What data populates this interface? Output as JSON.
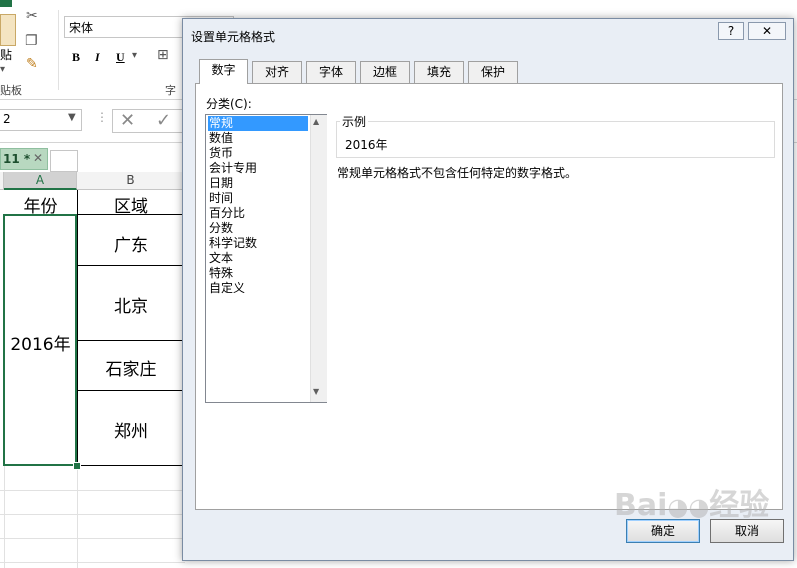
{
  "excel": {
    "ribbon": {
      "paste_label": "贴",
      "clipboard_group": "贴板",
      "font_group": "字",
      "font_name": "宋体",
      "bold": "B",
      "italic": "I",
      "underline": "U"
    },
    "formula_bar": {
      "name_box": "2"
    },
    "sheet_tab": {
      "label": "11 *",
      "close": "✕"
    },
    "grid": {
      "columns": [
        "A",
        "B"
      ],
      "header_cells": [
        "年份",
        "区域"
      ],
      "year_cell": "2016年",
      "regions": [
        "广东",
        "北京",
        "石家庄",
        "郑州"
      ]
    }
  },
  "dialog": {
    "title": "设置单元格格式",
    "help": "?",
    "close": "✕",
    "tabs": [
      "数字",
      "对齐",
      "字体",
      "边框",
      "填充",
      "保护"
    ],
    "active_tab": "数字",
    "category_label": "分类(C):",
    "categories": [
      "常规",
      "数值",
      "货币",
      "会计专用",
      "日期",
      "时间",
      "百分比",
      "分数",
      "科学记数",
      "文本",
      "特殊",
      "自定义"
    ],
    "selected_category": "常规",
    "sample_legend": "示例",
    "sample_value": "2016年",
    "description": "常规单元格格式不包含任何特定的数字格式。",
    "ok": "确定",
    "cancel": "取消"
  },
  "colors": {
    "excel_green": "#217346",
    "selection_blue": "#3399ff",
    "dialog_bg": "#e9eef5"
  }
}
